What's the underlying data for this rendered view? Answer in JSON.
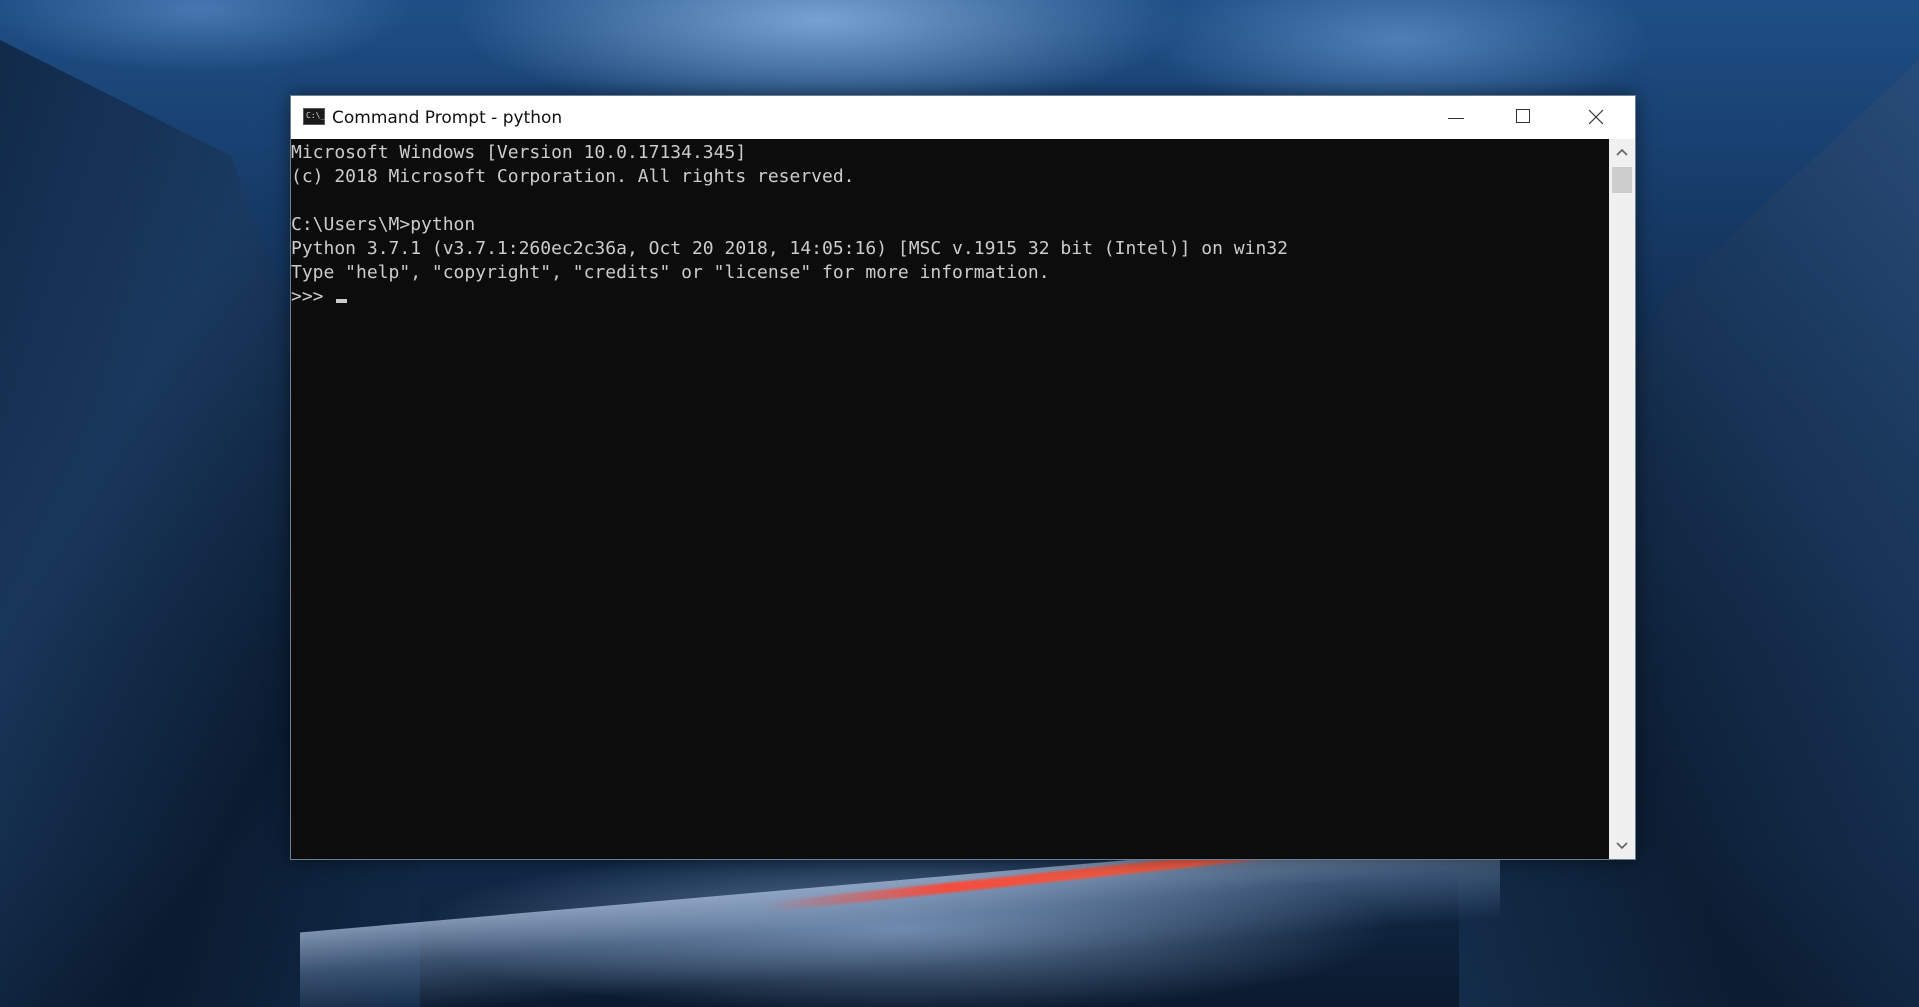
{
  "window": {
    "title": "Command Prompt - python",
    "icon": "command-prompt-icon"
  },
  "titlebar_buttons": {
    "minimize": "minimize-icon",
    "maximize": "maximize-icon",
    "close": "close-icon"
  },
  "console": {
    "lines": [
      "Microsoft Windows [Version 10.0.17134.345]",
      "(c) 2018 Microsoft Corporation. All rights reserved.",
      "",
      "C:\\Users\\M>python",
      "Python 3.7.1 (v3.7.1:260ec2c36a, Oct 20 2018, 14:05:16) [MSC v.1915 32 bit (Intel)] on win32",
      "Type \"help\", \"copyright\", \"credits\" or \"license\" for more information.",
      ">>> "
    ],
    "text_color": "#cccccc",
    "background_color": "#0c0c0c"
  },
  "scrollbar": {
    "up_icon": "chevron-up-icon",
    "down_icon": "chevron-down-icon"
  }
}
